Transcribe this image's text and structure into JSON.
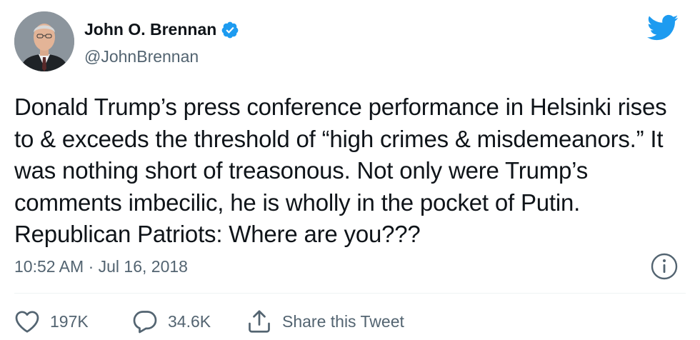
{
  "author": {
    "name": "John O. Brennan",
    "handle": "@JohnBrennan",
    "verified": true,
    "avatar": "profile-photo"
  },
  "tweet": {
    "text": "Donald Trump’s press conference performance in Helsinki rises to & exceeds the threshold of “high crimes & misdemeanors.” It was nothing short of treasonous. Not only were Trump’s comments imbecilic, he is wholly in the pocket of Putin. Republican Patriots: Where are you???",
    "timestamp": "10:52 AM · Jul 16, 2018"
  },
  "actions": {
    "like_count": "197K",
    "reply_count": "34.6K",
    "share_label": "Share this Tweet"
  },
  "icons": {
    "brand": "twitter-bird-icon",
    "verified": "verified-badge-icon",
    "info": "info-icon",
    "like": "heart-icon",
    "reply": "speech-bubble-icon",
    "share": "share-icon"
  },
  "colors": {
    "brand_blue": "#1d9bf0",
    "text_primary": "#0f1419",
    "text_secondary": "#536471"
  }
}
